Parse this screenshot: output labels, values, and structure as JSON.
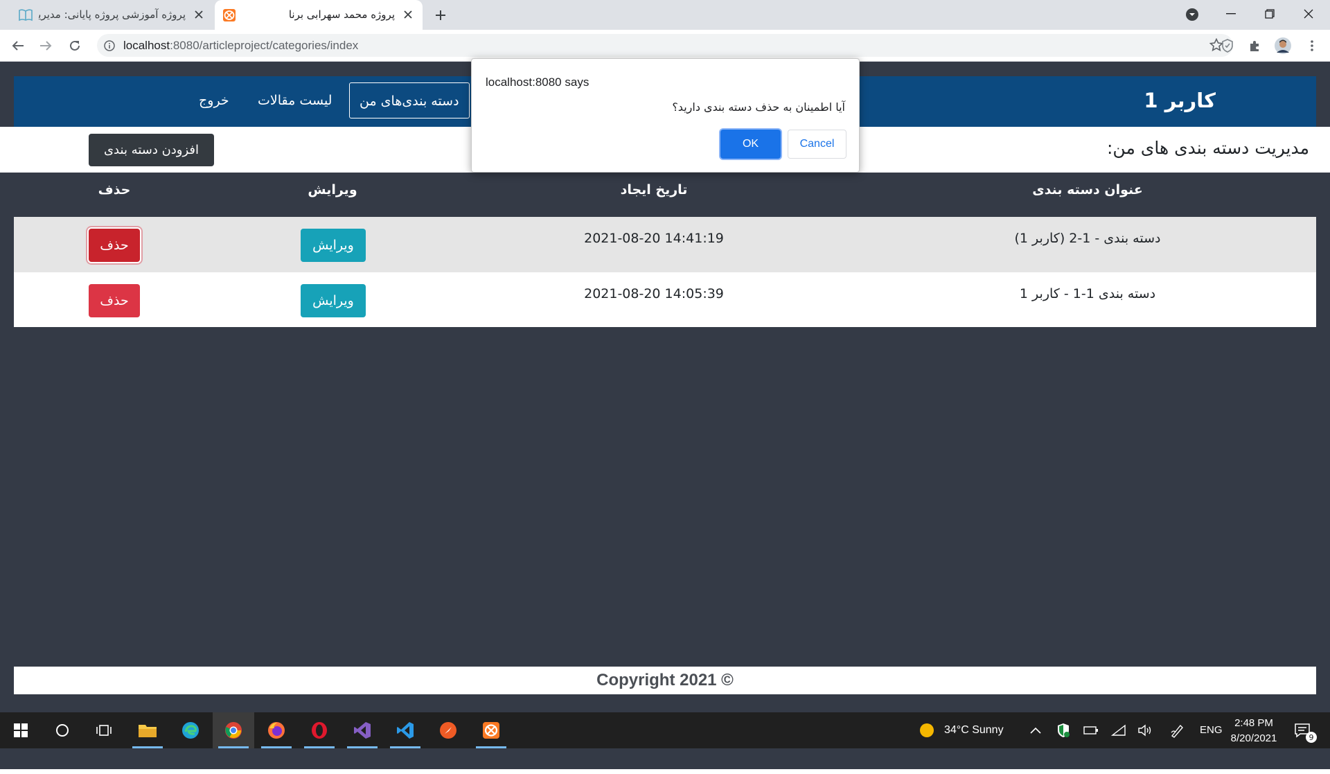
{
  "browser": {
    "tabs": [
      {
        "title": "پروژه آموزشی پروژه پایانی: مدیریت",
        "active": false,
        "icon": "book-icon"
      },
      {
        "title": "پروژه محمد سهرابی برنا",
        "active": true,
        "icon": "xampp-icon"
      }
    ],
    "url_host": "localhost",
    "url_rest": ":8080/articleproject/categories/index"
  },
  "navbar": {
    "brand": "کاربر 1",
    "links": [
      "دسته بندی‌های من",
      "لیست مقالات",
      "خروج"
    ]
  },
  "header": {
    "title": "مدیریت دسته بندی های من:",
    "add_button": "افزودن دسته بندی"
  },
  "table": {
    "headers": [
      "عنوان دسته بندی",
      "تاریخ ایجاد",
      "ویرایش",
      "حذف"
    ],
    "rows": [
      {
        "title": "دسته بندی - 1-2 (کاربر 1)",
        "date": "2021-08-20 14:41:19",
        "edit": "ویرایش",
        "delete": "حذف"
      },
      {
        "title": "دسته بندی 1-1 - کاربر 1",
        "date": "2021-08-20 14:05:39",
        "edit": "ویرایش",
        "delete": "حذف"
      }
    ]
  },
  "footer": {
    "text": "Copyright 2021 ©"
  },
  "dialog": {
    "title": "localhost:8080 says",
    "message": "آیا اطمینان به حذف دسته بندی دارید؟",
    "ok": "OK",
    "cancel": "Cancel"
  },
  "taskbar": {
    "weather": "34°C  Sunny",
    "lang": "ENG",
    "time": "2:48 PM",
    "date": "8/20/2021",
    "notifications": "9"
  },
  "colors": {
    "navbar": "#0c4a80",
    "page_bg": "#343a46",
    "edit": "#17a2b8",
    "delete": "#dc3545",
    "ok": "#1a73e8"
  }
}
